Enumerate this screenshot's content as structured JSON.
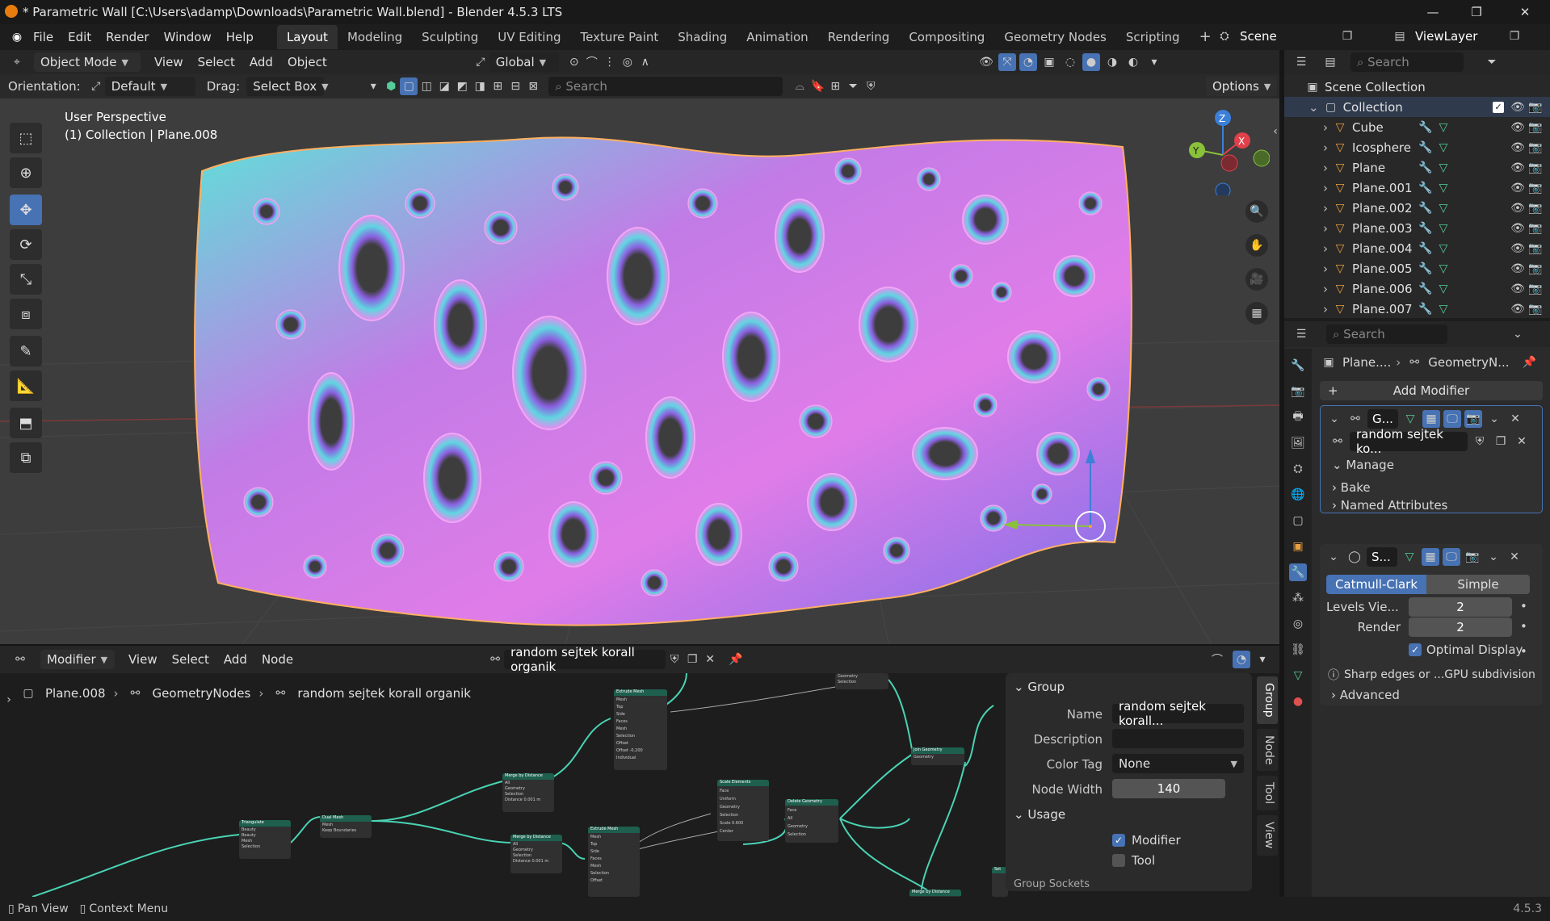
{
  "window": {
    "title": "* Parametric Wall [C:\\Users\\adamp\\Downloads\\Parametric Wall.blend] - Blender 4.5.3 LTS",
    "controls": [
      "minimize",
      "maximize",
      "close"
    ]
  },
  "menubar": {
    "items": [
      "File",
      "Edit",
      "Render",
      "Window",
      "Help"
    ],
    "workspaces": [
      "Layout",
      "Modeling",
      "Sculpting",
      "UV Editing",
      "Texture Paint",
      "Shading",
      "Animation",
      "Rendering",
      "Compositing",
      "Geometry Nodes",
      "Scripting"
    ],
    "active_workspace": "Layout",
    "add_tab": "+",
    "scene": "Scene",
    "view_layer": "ViewLayer"
  },
  "viewport_header": {
    "mode": "Object Mode",
    "menus": [
      "View",
      "Select",
      "Add",
      "Object"
    ],
    "transform_orientation": "Global",
    "orientation_label": "Orientation:",
    "orientation_value": "Default",
    "drag_label": "Drag:",
    "drag_value": "Select Box",
    "search_placeholder": "Search",
    "options": "Options"
  },
  "viewport": {
    "perspective": "User Perspective",
    "context": "(1) Collection | Plane.008",
    "gizmo_axes": [
      "X",
      "Y",
      "Z"
    ]
  },
  "node_editor": {
    "editor_type": "Modifier",
    "menus": [
      "View",
      "Select",
      "Add",
      "Node"
    ],
    "node_group": "random sejtek korall organik",
    "breadcrumb": [
      "Plane.008",
      "GeometryNodes",
      "random sejtek korall organik"
    ],
    "nodes": [
      {
        "title": "Triangulate",
        "rows": [
          "Beauty",
          "Beauty",
          "Mesh",
          "Selection"
        ]
      },
      {
        "title": "Dual Mesh",
        "rows": [
          "Mesh",
          "Keep Boundaries"
        ]
      },
      {
        "title": "Merge by Distance",
        "rows": [
          "All",
          "Geometry",
          "Selection",
          "Distance  0.001 m"
        ]
      },
      {
        "title": "Merge by Distance",
        "rows": [
          "All",
          "Geometry",
          "Selection",
          "Distance  0.001 m"
        ]
      },
      {
        "title": "Extrude Mesh",
        "rows": [
          "Mesh",
          "Top",
          "Side",
          "Faces",
          "Mesh",
          "Selection",
          "Offset",
          "Offset  -0.200",
          "Individual"
        ]
      },
      {
        "title": "Extrude Mesh",
        "rows": [
          "Mesh",
          "Top",
          "Side",
          "Faces",
          "Mesh",
          "Selection",
          "Offset"
        ]
      },
      {
        "title": "Scale Elements",
        "rows": [
          "Face",
          "Uniform",
          "Geometry",
          "Selection",
          "Scale  0.600",
          "Center"
        ]
      },
      {
        "title": "Delete Geometry",
        "rows": [
          "Face",
          "All",
          "Geometry",
          "Selection"
        ]
      },
      {
        "title": "Join Geometry",
        "rows": [
          "Geometry"
        ]
      },
      {
        "title": "",
        "rows": [
          "Geometry",
          "Selection"
        ]
      },
      {
        "title": "Merge by Distance",
        "rows": []
      },
      {
        "title": "Set",
        "rows": []
      }
    ],
    "side_tabs": [
      "Group",
      "Node",
      "Tool",
      "View"
    ],
    "group_panel": {
      "section": "Group",
      "name_label": "Name",
      "name_value": "random sejtek korall...",
      "description_label": "Description",
      "description_value": "",
      "color_tag_label": "Color Tag",
      "color_tag_value": "None",
      "node_width_label": "Node Width",
      "node_width_value": "140",
      "usage_section": "Usage",
      "modifier_label": "Modifier",
      "modifier_checked": true,
      "tool_label": "Tool",
      "tool_checked": false,
      "group_sockets": "Group Sockets"
    }
  },
  "outliner": {
    "search_placeholder": "Search",
    "scene_collection": "Scene Collection",
    "collection": "Collection",
    "items": [
      "Cube",
      "Icosphere",
      "Plane",
      "Plane.001",
      "Plane.002",
      "Plane.003",
      "Plane.004",
      "Plane.005",
      "Plane.006",
      "Plane.007"
    ]
  },
  "properties": {
    "search_placeholder": "Search",
    "breadcrumb_object": "Plane....",
    "breadcrumb_modifier": "GeometryN...",
    "add_modifier": "Add Modifier",
    "geonodes_modifier": {
      "name": "G...",
      "node_group": "random sejtek ko...",
      "sections": [
        "Manage",
        "Bake",
        "Named Attributes"
      ]
    },
    "subsurf_modifier": {
      "name": "S...",
      "modes": [
        "Catmull-Clark",
        "Simple"
      ],
      "active_mode": "Catmull-Clark",
      "levels_viewport_label": "Levels Vie...",
      "levels_viewport": "2",
      "render_label": "Render",
      "render_value": "2",
      "optimal_display_label": "Optimal Display",
      "optimal_display": true,
      "sharp_edges_label": "Sharp edges or ...GPU subdivision",
      "advanced": "Advanced"
    }
  },
  "statusbar": {
    "left_1": "Pan View",
    "left_2": "Context Menu",
    "version": "4.5.3"
  },
  "colors": {
    "accent_blue": "#4772b3",
    "node_header_green": "#1e5f4e",
    "node_link": "#4ad3b4",
    "axis_x": "#e0414a",
    "axis_y": "#8ac13a",
    "axis_z": "#3b7fd9",
    "mesh_pink": "#e07ce8",
    "mesh_cyan": "#5fe0d8"
  }
}
